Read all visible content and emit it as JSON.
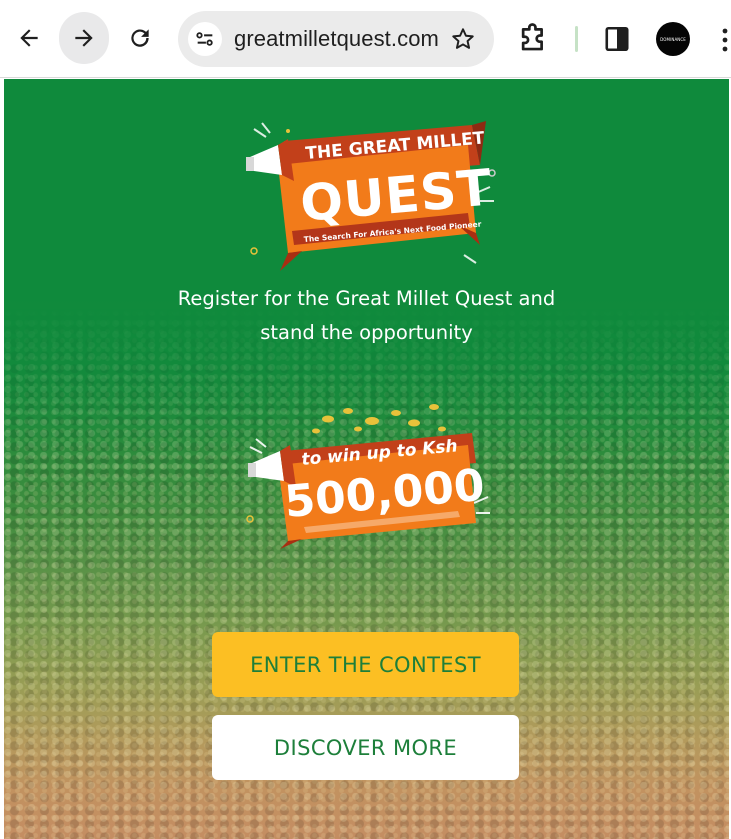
{
  "browser": {
    "url": "greatmilletquest.com",
    "profile_label": "DOMINANCE",
    "icons": {
      "back": "arrow-left-icon",
      "forward": "arrow-right-icon",
      "reload": "reload-icon",
      "site_info": "tune-icon",
      "bookmark": "star-icon",
      "extensions": "puzzle-icon",
      "side_panel": "side-panel-icon",
      "menu": "kebab-menu-icon"
    }
  },
  "hero": {
    "logo": {
      "line1": "THE GREAT MILLET",
      "line2": "QUEST",
      "tagline": "The Search For Africa's Next Food Pioneer"
    },
    "intro_line1": "Register for the Great Millet Quest and",
    "intro_line2": "stand the opportunity",
    "prize": {
      "line1": "to win up to Ksh",
      "amount": "500,000"
    }
  },
  "actions": {
    "enter_label": "ENTER THE CONTEST",
    "discover_label": "DISCOVER MORE"
  },
  "colors": {
    "page_green": "#0f8a3c",
    "banner_orange": "#f27b1a",
    "banner_dark": "#c2401a",
    "button_yellow": "#fcbf23",
    "button_text_green": "#1d7f3a"
  }
}
